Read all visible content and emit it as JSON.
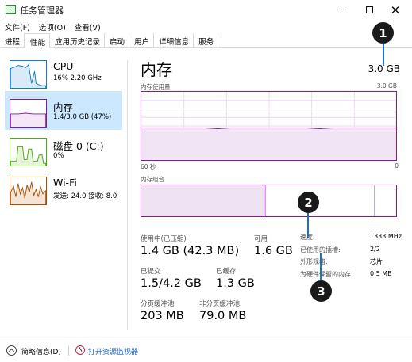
{
  "window": {
    "title": "任务管理器"
  },
  "menu": [
    "文件(F)",
    "选项(O)",
    "查看(V)"
  ],
  "tabs": [
    "进程",
    "性能",
    "应用历史记录",
    "启动",
    "用户",
    "详细信息",
    "服务"
  ],
  "sidebar": [
    {
      "title": "CPU",
      "sub": "16%  2.20 GHz"
    },
    {
      "title": "内存",
      "sub": "1.4/3.0 GB (47%)"
    },
    {
      "title": "磁盘 0 (C:)",
      "sub": "0%"
    },
    {
      "title": "Wi-Fi",
      "sub": "发送: 24.0  接收: 8.0"
    }
  ],
  "main": {
    "title": "内存",
    "total": "3.0 GB",
    "usage_label": "内存使用量",
    "usage_max": "3.0 GB",
    "time_label": "60 秒",
    "zero_label": "0",
    "composition_label": "内存组合"
  },
  "stats": {
    "in_use_label": "使用中(已压缩)",
    "in_use_value": "1.4 GB (42.3 MB)",
    "available_label": "可用",
    "available_value": "1.6 GB",
    "committed_label": "已提交",
    "committed_value": "1.5/4.2 GB",
    "cached_label": "已缓存",
    "cached_value": "1.3 GB",
    "paged_label": "分页缓冲池",
    "paged_value": "203 MB",
    "nonpaged_label": "非分页缓冲池",
    "nonpaged_value": "79.0 MB"
  },
  "details": [
    {
      "label": "速度:",
      "value": "1333 MHz"
    },
    {
      "label": "已使用的插槽:",
      "value": "2/2"
    },
    {
      "label": "外形规格:",
      "value": "芯片"
    },
    {
      "label": "为硬件保留的内存:",
      "value": "0.5 MB"
    }
  ],
  "footer": {
    "brief": "简略信息(D)",
    "monitor": "打开资源监视器"
  },
  "callouts": [
    "1",
    "2",
    "3"
  ],
  "memory_usage_level": 0.47,
  "colors": {
    "memory": "#8b12ae",
    "cpu": "#117dbb",
    "disk": "#4da60c",
    "wifi": "#a74f01",
    "selected": "#cce8ff"
  }
}
